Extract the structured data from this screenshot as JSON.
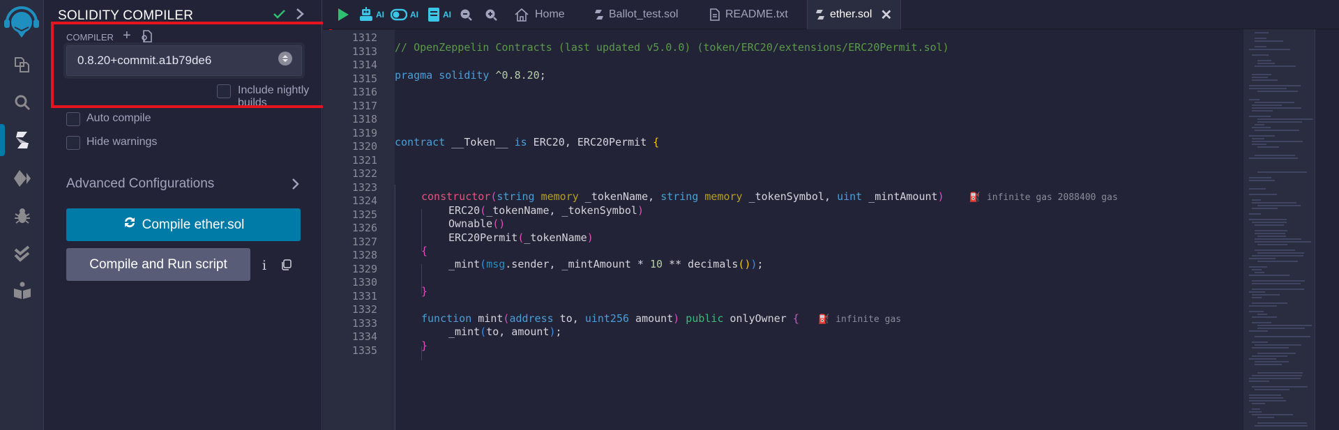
{
  "rail": {
    "items": [
      {
        "name": "file-explorer",
        "icon": "files-icon"
      },
      {
        "name": "search",
        "icon": "search-icon"
      },
      {
        "name": "solidity-compiler",
        "icon": "solidity-icon",
        "active": true
      },
      {
        "name": "deploy-run",
        "icon": "ethereum-icon"
      },
      {
        "name": "debugger",
        "icon": "bug-icon"
      },
      {
        "name": "testing",
        "icon": "double-check-icon"
      },
      {
        "name": "learneth",
        "icon": "book-reader-icon"
      }
    ]
  },
  "panel": {
    "title": "SOLIDITY COMPILER",
    "compiler_label": "COMPILER",
    "compiler_version": "0.8.20+commit.a1b79de6",
    "include_nightly_label": "Include nightly builds",
    "include_nightly_checked": false,
    "auto_compile_label": "Auto compile",
    "auto_compile_checked": false,
    "hide_warnings_label": "Hide warnings",
    "hide_warnings_checked": false,
    "advanced_label": "Advanced Configurations",
    "compile_button": "Compile ether.sol",
    "run_script_button": "Compile and Run script",
    "info_label": "i"
  },
  "toolbar": {
    "ai_label": "AI",
    "accent_color": "#3bc5e6"
  },
  "tabs": [
    {
      "label": "Home",
      "icon": "home-icon",
      "active": false
    },
    {
      "label": "Ballot_test.sol",
      "icon": "solidity-icon",
      "active": false
    },
    {
      "label": "README.txt",
      "icon": "file-text-icon",
      "active": false
    },
    {
      "label": "ether.sol",
      "icon": "solidity-icon",
      "active": true
    }
  ],
  "editor": {
    "line_numbers": [
      "1312",
      "1313",
      "1314",
      "1315",
      "1316",
      "1317",
      "1318",
      "1319",
      "1320",
      "1321",
      "1322",
      "1323",
      "1324",
      "1325",
      "1326",
      "1327",
      "1328",
      "1329",
      "1330",
      "1331",
      "1332",
      "1333",
      "1334",
      "1335"
    ],
    "code": {
      "l1313": "// OpenZeppelin Contracts (last updated v5.0.0) (token/ERC20/extensions/ERC20Permit.sol)",
      "l1315": {
        "kw1": "pragma",
        "kw2": "solidity",
        "ver": "^0.8.20",
        "semi": ";"
      },
      "l1320": {
        "kw": "contract",
        "name": " __Token__ ",
        "is": "is",
        "rest": " ERC20, ERC20Permit ",
        "brace": "{"
      },
      "l1324": {
        "ctor": "constructor",
        "p1": "(",
        "t1": "string",
        "m1": "memory",
        "a1": " _tokenName, ",
        "t2": "string",
        "m2": "memory",
        "a2": " _tokenSymbol, ",
        "t3": "uint",
        "a3": " _mintAmount",
        "p2": ")",
        "gas": "infinite gas 2088400 gas"
      },
      "l1325": {
        "f": "ERC20",
        "p1": "(",
        "args": "_tokenName, _tokenSymbol",
        "p2": ")"
      },
      "l1326": {
        "f": "Ownable",
        "p": "()"
      },
      "l1327": {
        "f": "ERC20Permit",
        "p1": "(",
        "args": "_tokenName",
        "p2": ")"
      },
      "l1328": "{",
      "l1329": {
        "f": "_mint",
        "p1": "(",
        "msg": "msg",
        "a1": ".sender, _mintAmount * ",
        "num": "10",
        "a2": " ** decimals",
        "p3": "()",
        "p2": ")",
        "semi": ";"
      },
      "l1331": "}",
      "l1333": {
        "kw": "function",
        "name": " mint",
        "p1": "(",
        "t1": "address",
        "a1": " to, ",
        "t2": "uint256",
        "a2": " amount",
        "p2": ")",
        "pub": " public",
        "mod": " onlyOwner ",
        "brace": "{",
        "gas": "infinite gas"
      },
      "l1334": {
        "f": "_mint",
        "p1": "(",
        "args": "to, amount",
        "p2": ")",
        "semi": ";"
      },
      "l1335": "}"
    }
  }
}
